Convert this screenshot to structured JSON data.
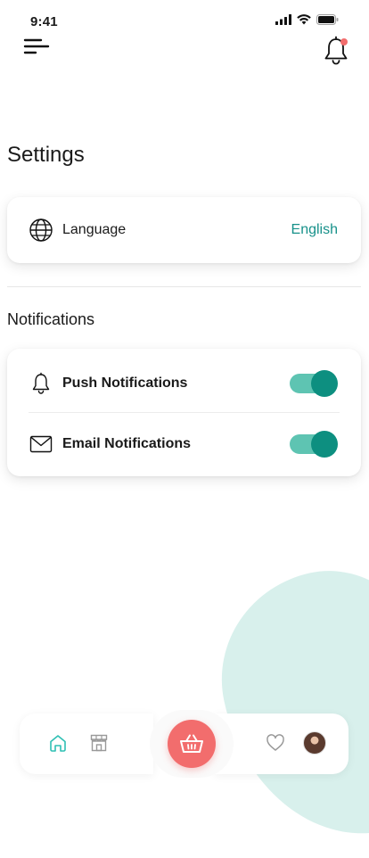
{
  "status_bar": {
    "time": "9:41"
  },
  "header": {
    "menu_icon": "hamburger-menu-icon",
    "notification_icon": "bell-icon",
    "notification_dot_color": "#f26d6d"
  },
  "page": {
    "title": "Settings"
  },
  "language": {
    "icon": "globe-icon",
    "label": "Language",
    "value": "English"
  },
  "notifications": {
    "section_title": "Notifications",
    "items": [
      {
        "icon": "bell-icon",
        "label": "Push Notifications",
        "enabled": true
      },
      {
        "icon": "mail-icon",
        "label": "Email Notifications",
        "enabled": true
      }
    ]
  },
  "bottom_nav": {
    "items": [
      {
        "icon": "home-icon",
        "active": true
      },
      {
        "icon": "store-icon",
        "active": false
      },
      {
        "icon": "basket-icon",
        "active": false
      },
      {
        "icon": "heart-icon",
        "active": false
      },
      {
        "icon": "avatar",
        "active": false
      }
    ]
  },
  "colors": {
    "accent": "#17918a",
    "toggle_track": "#5ec4b2",
    "toggle_knob": "#0d8f80",
    "cart": "#f26d6d",
    "blob": "#d8f0ec"
  }
}
